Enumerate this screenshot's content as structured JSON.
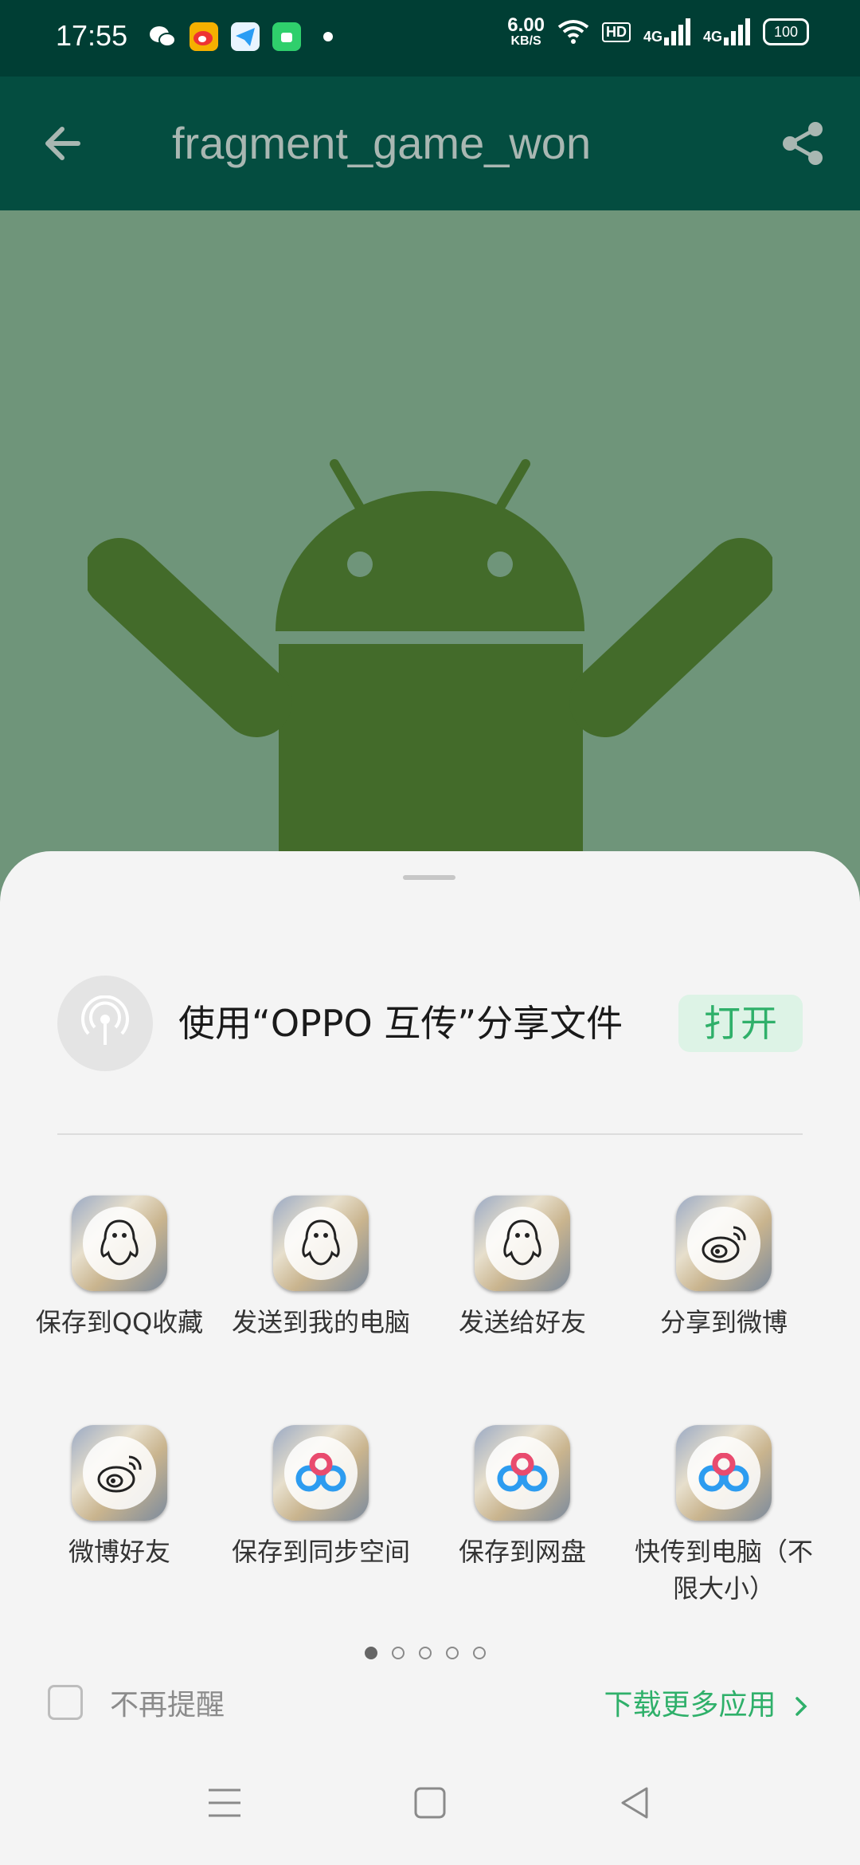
{
  "status_bar": {
    "time": "17:55",
    "net_speed_value": "6.00",
    "net_speed_unit": "KB/S",
    "hd_label": "HD",
    "signal_1": "4G",
    "signal_2": "4G",
    "battery": "100",
    "notification_icons": [
      "wechat-icon",
      "weibo-icon",
      "telegram-icon",
      "android-app-icon",
      "dot-icon"
    ]
  },
  "app_bar": {
    "title": "fragment_game_won",
    "back_icon": "arrow-left-icon",
    "share_icon": "share-icon"
  },
  "share_sheet": {
    "oppo_share": {
      "text": "使用“OPPO 互传”分享文件",
      "button": "打开",
      "icon": "oppo-share-icon"
    },
    "targets": [
      {
        "label": "保存到QQ收藏",
        "icon": "qq-icon"
      },
      {
        "label": "发送到我的电脑",
        "icon": "qq-icon"
      },
      {
        "label": "发送给好友",
        "icon": "qq-icon"
      },
      {
        "label": "分享到微博",
        "icon": "weibo-icon"
      },
      {
        "label": "微博好友",
        "icon": "weibo-icon"
      },
      {
        "label": "保存到同步空间",
        "icon": "baidu-cloud-icon"
      },
      {
        "label": "保存到网盘",
        "icon": "baidu-cloud-icon"
      },
      {
        "label": "快传到电脑（不限大小）",
        "icon": "baidu-cloud-icon"
      }
    ],
    "page_indicator": {
      "total": 5,
      "current": 1
    },
    "dont_remind": "不再提醒",
    "more_apps": "下载更多应用"
  },
  "colors": {
    "status_bar": "#003e34",
    "app_bar": "#044d40",
    "content_bg": "#6f957a",
    "android": "#436b2a",
    "accent_green": "#2fb06a"
  }
}
